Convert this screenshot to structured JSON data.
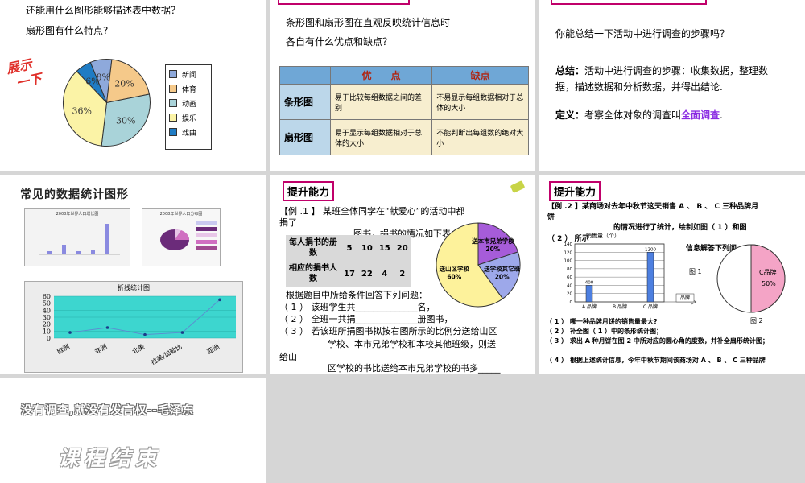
{
  "slide1": {
    "q1": "还能用什么图形能够描述表中数据？",
    "q2": "扇形图有什么特点?",
    "stamp": [
      "展示",
      "一下"
    ],
    "pie": [
      {
        "label": "新闻",
        "pct": "8%",
        "value": 8,
        "color": "#8ea9db"
      },
      {
        "label": "体育",
        "pct": "20%",
        "value": 20,
        "color": "#f5c98a"
      },
      {
        "label": "动画",
        "pct": "30%",
        "value": 30,
        "color": "#a9d3d9"
      },
      {
        "label": "娱乐",
        "pct": "36%",
        "value": 36,
        "color": "#fbf3a6"
      },
      {
        "label": "戏曲",
        "pct": "6%",
        "value": 6,
        "color": "#1f7cc4"
      }
    ]
  },
  "slide2": {
    "text1": "条形图和扇形图在直观反映统计信息时",
    "text2": "各自有什么优点和缺点？",
    "headers": [
      "优　　点",
      "缺点"
    ],
    "rows": [
      {
        "name": "条形图",
        "pro": "易于比较每组数据之间的差别",
        "con": "不易显示每组数据相对于总体的大小"
      },
      {
        "name": "扇形图",
        "pro": "易于显示每组数据相对于总体的大小",
        "con": "不能判断出每组数的绝对大小"
      }
    ]
  },
  "slide3": {
    "question": "你能总结一下活动中进行调查的步骤吗？",
    "summary_label": "总结：",
    "summary": "活动中进行调查的步骤：收集数据，整理数据，描述数据和分析数据，并得出结论.",
    "def_label": "定义：",
    "def_text": "考察全体对象的调查叫",
    "def_term": "全面调查",
    "def_end": "."
  },
  "slide4": {
    "title": "常见的数据统计图形",
    "bar_title": "2008年世界人口增长图",
    "pie_title": "2008年世界人口分布图",
    "line_title": "折线统计图",
    "line_labels": [
      "欧洲",
      "非洲",
      "北美",
      "拉美/加勒比",
      "亚洲"
    ],
    "line_values": [
      8,
      15,
      5,
      8,
      55
    ],
    "line_ticks": [
      "60",
      "50",
      "40",
      "30",
      "20",
      "10",
      "0"
    ]
  },
  "slide5": {
    "header": "提升能力",
    "intro1": "【例 .1 】 某班全体同学在“献爱心”的活动中都",
    "intro2": "捐了",
    "intro3": "图书，捐书的情况如下表：",
    "table_row1": [
      "每人捐书的册数",
      "5",
      "10",
      "15",
      "20"
    ],
    "table_row2": [
      "相应的捐书人数",
      "17",
      "22",
      "4",
      "2"
    ],
    "q0": "根据题目中所给条件回答下列问题：",
    "q1": "（ 1 ） 该班学生共______________名，",
    "q2": "（ 2 ） 全班一共捐______________册图书，",
    "q3": "（ 3 ） 若该班所捐图书拟按右图所示的比例分送给山区",
    "q4": "学校、本市兄弟学校和本校其他班级，则送",
    "q5": "给山",
    "q6": "区学校的书比送给本市兄弟学校的书多_____",
    "pie": [
      {
        "label": "送山区学校",
        "pct": "60%",
        "value": 60,
        "color": "#fdf29b"
      },
      {
        "label": "送本市兄弟学校",
        "pct": "20%",
        "value": 20,
        "color": "#a65cd9"
      },
      {
        "label": "送学校其它班",
        "pct": "20%",
        "value": 20,
        "color": "#9da8ea"
      }
    ]
  },
  "slide6": {
    "header": "提升能力",
    "intro1": "【例 .2 】某商场对去年中秋节这天销售 A 、 B 、 C 三种品牌月",
    "intro2": "饼",
    "intro3": "的情况进行了统计，绘制如图（ 1 ）和图",
    "intro4": "（ 2 ） 所示",
    "intro5": "信息解答下列问",
    "ylabel": "销售量（个）",
    "yticks": [
      "140",
      "120",
      "100",
      "80",
      "60",
      "40",
      "20",
      "0"
    ],
    "bars": [
      {
        "label": "A 品牌",
        "value": 400,
        "display": "400"
      },
      {
        "label": "B 品牌",
        "value": 0,
        "display": ""
      },
      {
        "label": "C 品牌",
        "value": 1200,
        "display": "1200"
      }
    ],
    "xlabel": "品牌",
    "fig1": "图 1",
    "fig2": "图 2",
    "pie_label": "C品牌",
    "pie_pct": "50%",
    "q1": "（ 1 ） 哪一种品牌月饼的销售量最大?",
    "q2": "（ 2 ） 补全图（ 1 ）中的条形统计图；",
    "q3": "（ 3 ） 求出 A 种月饼在图 2 中所对应的圆心角的度数，并补全扇形统计图；",
    "q4": "（ 4 ） 根据上述统计信息，今年中秋节期间该商场对 A 、 B 、 C 三种品牌"
  },
  "slide7": {
    "quote": "没有调查,就没有发言权--毛泽东",
    "end": "课程结束"
  }
}
